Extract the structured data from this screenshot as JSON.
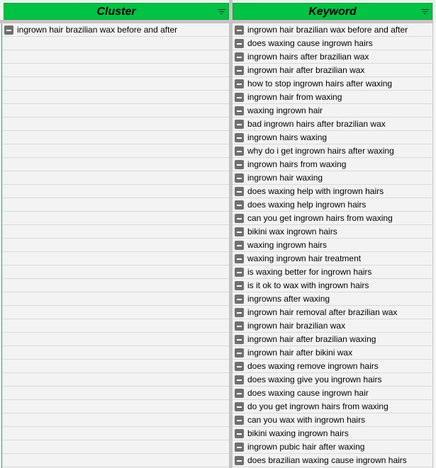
{
  "columns": {
    "cluster": "Cluster",
    "keyword": "Keyword"
  },
  "cluster_rows": [
    "ingrown hair brazilian wax before and after"
  ],
  "keywords": [
    "ingrown hair brazilian wax before and after",
    "does waxing cause ingrown hairs",
    "ingrown hairs after brazilian wax",
    "ingrown hair after brazilian wax",
    "how to stop ingrown hairs after waxing",
    "ingrown hair from waxing",
    "waxing ingrown hair",
    "bad ingrown hairs after brazilian wax",
    "ingrown hairs waxing",
    "why do i get ingrown hairs after waxing",
    "ingrown hairs from waxing",
    "ingrown hair waxing",
    "does waxing help with ingrown hairs",
    "does waxing help ingrown hairs",
    "can you get ingrown hairs from waxing",
    "bikini wax ingrown hairs",
    "waxing ingrown hairs",
    "waxing ingrown hair treatment",
    "is waxing better for ingrown hairs",
    "is it ok to wax with ingrown hairs",
    "ingrowns after waxing",
    "ingrown hair removal after brazilian wax",
    "ingrown hair brazilian wax",
    "ingrown hair after brazilian waxing",
    "ingrown hair after bikini wax",
    "does waxing remove ingrown hairs",
    "does waxing give you ingrown hairs",
    "does waxing cause ingrown hair",
    "do you get ingrown hairs from waxing",
    "can you wax with ingrown hairs",
    "bikini waxing ingrown hairs",
    "ingrown pubic hair after waxing",
    "does brazilian waxing cause ingrown hairs"
  ],
  "colors": {
    "header": "#00c244",
    "group_icon": "#6f6f6f"
  }
}
